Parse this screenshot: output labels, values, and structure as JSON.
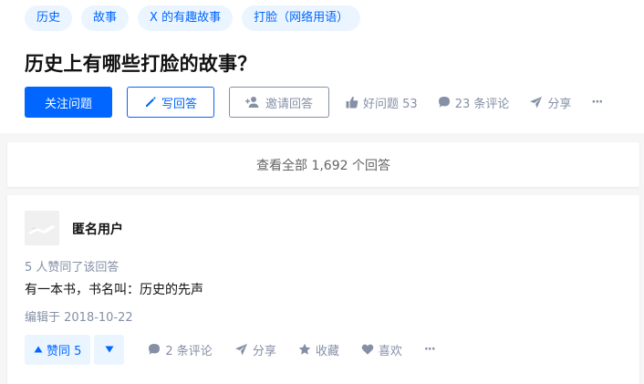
{
  "question": {
    "tags": [
      "历史",
      "故事",
      "X 的有趣故事",
      "打脸（网络用语）"
    ],
    "title": "历史上有哪些打脸的故事？",
    "actions": {
      "follow": "关注问题",
      "write": "写回答",
      "invite": "邀请回答",
      "good_question": "好问题 53",
      "comments": "23 条评论",
      "share": "分享",
      "more": "···"
    }
  },
  "view_all": "查看全部 1,692 个回答",
  "answer": {
    "author": "匿名用户",
    "voters": "5 人赞同了该回答",
    "content": "有一本书，书名叫：历史的先声",
    "edited": "编辑于 2018-10-22",
    "actions": {
      "upvote": "赞同 5",
      "comments": "2 条评论",
      "share": "分享",
      "collect": "收藏",
      "like": "喜欢",
      "more": "···"
    }
  },
  "colors": {
    "brand": "#0066ff",
    "tag_bg": "#ebf5ff",
    "muted": "#8590a6",
    "page_bg": "#f6f6f6"
  }
}
